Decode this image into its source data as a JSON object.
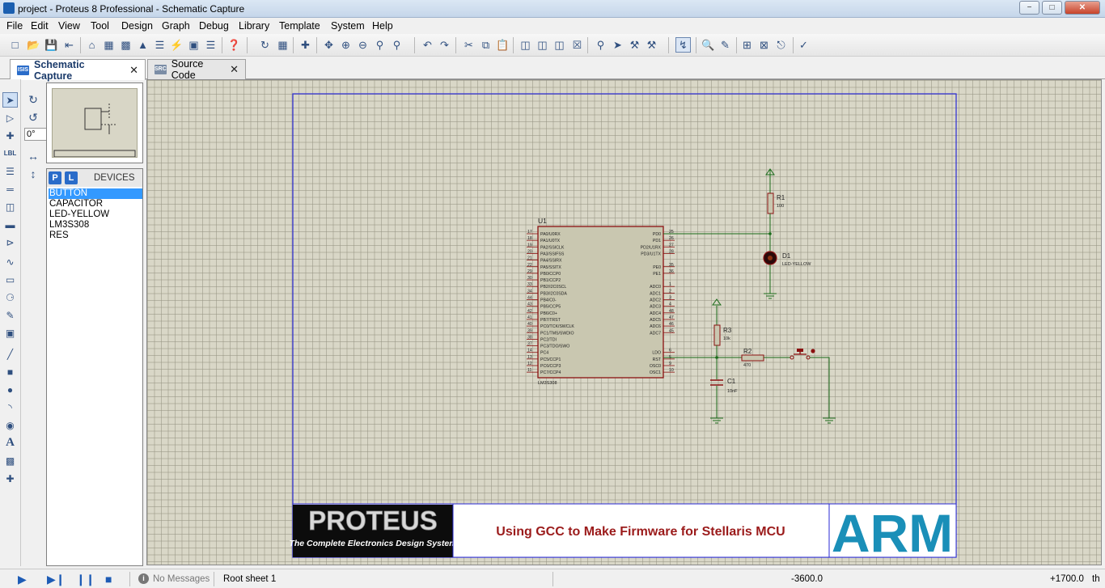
{
  "window": {
    "title": "project - Proteus 8 Professional - Schematic Capture",
    "minimize": "−",
    "maximize": "□",
    "close": "✕"
  },
  "menu": [
    "File",
    "Edit",
    "View",
    "Tool",
    "Design",
    "Graph",
    "Debug",
    "Library",
    "Template",
    "System",
    "Help"
  ],
  "toolbar": {
    "icons": [
      "new-icon",
      "open-icon",
      "save-icon",
      "import-icon",
      "home-icon",
      "schematic-icon",
      "pcb-icon",
      "3d-icon",
      "bom-icon",
      "help-icon",
      "refresh-icon",
      "grid-icon",
      "origin-icon",
      "pan-icon",
      "zoom-in-icon",
      "zoom-out-icon",
      "zoom-all-icon",
      "zoom-area-icon",
      "undo-icon",
      "redo-icon",
      "cut-icon",
      "copy-icon",
      "paste-icon",
      "block-copy-icon",
      "block-move-icon",
      "block-rotate-icon",
      "block-delete-icon",
      "pick-icon",
      "make-device-icon",
      "packaging-icon",
      "decompose-icon",
      "wire-autorouter-icon",
      "search-icon",
      "property-assign-icon",
      "new-sheet-icon",
      "remove-sheet-icon",
      "exit-to-parent-icon",
      "electrical-rule-check-icon"
    ]
  },
  "tabs": [
    {
      "label": "Schematic Capture",
      "icon": "ISIS",
      "active": true,
      "close": "✕"
    },
    {
      "label": "Source Code",
      "icon": "SRC",
      "active": false,
      "close": "✕"
    }
  ],
  "rotation": {
    "angle": "0°"
  },
  "devices": {
    "p_label": "P",
    "l_label": "L",
    "title": "DEVICES",
    "items": [
      "BUTTON",
      "CAPACITOR",
      "LED-YELLOW",
      "LM3S308",
      "RES"
    ],
    "selected_index": 0
  },
  "schematic": {
    "mcu": {
      "ref": "U1",
      "part": "LM3S308",
      "left_pins": [
        {
          "num": "17",
          "name": "PA0/U0RX"
        },
        {
          "num": "18",
          "name": "PA1/U0TX"
        },
        {
          "num": "19",
          "name": "PA2/SSICLK"
        },
        {
          "num": "20",
          "name": "PA3/SSIFSS"
        },
        {
          "num": "21",
          "name": "PA4/SSIRX"
        },
        {
          "num": "22",
          "name": "PA5/SSITX"
        },
        {
          "num": "29",
          "name": "PB0/CCP0"
        },
        {
          "num": "30",
          "name": "PB1/CCP2"
        },
        {
          "num": "33",
          "name": "PB2/I2C0SCL"
        },
        {
          "num": "34",
          "name": "PB3/I2C0SDA"
        },
        {
          "num": "44",
          "name": "PB4/C0-"
        },
        {
          "num": "43",
          "name": "PB5/CCP5"
        },
        {
          "num": "42",
          "name": "PB6/C0+"
        },
        {
          "num": "41",
          "name": "PB7/TRST"
        },
        {
          "num": "40",
          "name": "PC0/TCK/SWCLK"
        },
        {
          "num": "39",
          "name": "PC1/TMS/SWDIO"
        },
        {
          "num": "38",
          "name": "PC2/TDI"
        },
        {
          "num": "37",
          "name": "PC3/TDO/SWO"
        },
        {
          "num": "14",
          "name": "PC4"
        },
        {
          "num": "13",
          "name": "PC5/CCP1"
        },
        {
          "num": "12",
          "name": "PC6/CCP3"
        },
        {
          "num": "11",
          "name": "PC7/CCP4"
        }
      ],
      "right_pins": [
        {
          "num": "25",
          "name": "PD0",
          "row": 0
        },
        {
          "num": "26",
          "name": "PD1",
          "row": 1
        },
        {
          "num": "27",
          "name": "PD2/U1RX",
          "row": 2
        },
        {
          "num": "28",
          "name": "PD3/U1TX",
          "row": 3
        },
        {
          "num": "35",
          "name": "PE0",
          "row": 5
        },
        {
          "num": "36",
          "name": "PE1",
          "row": 6
        },
        {
          "num": "1",
          "name": "ADC0",
          "row": 8
        },
        {
          "num": "2",
          "name": "ADC1",
          "row": 9
        },
        {
          "num": "3",
          "name": "ADC2",
          "row": 10
        },
        {
          "num": "4",
          "name": "ADC3",
          "row": 11
        },
        {
          "num": "48",
          "name": "ADC4",
          "row": 12
        },
        {
          "num": "47",
          "name": "ADC5",
          "row": 13
        },
        {
          "num": "46",
          "name": "ADC6",
          "row": 14
        },
        {
          "num": "45",
          "name": "ADC7",
          "row": 15
        },
        {
          "num": "6",
          "name": "LDO",
          "row": 18
        },
        {
          "num": "5",
          "name": "RST",
          "row": 19
        },
        {
          "num": "9",
          "name": "OSC0",
          "row": 20
        },
        {
          "num": "10",
          "name": "OSC1",
          "row": 21
        }
      ]
    },
    "r1": {
      "ref": "R1",
      "value": "100"
    },
    "d1": {
      "ref": "D1",
      "value": "LED-YELLOW"
    },
    "r3": {
      "ref": "R3",
      "value": "10k"
    },
    "r2": {
      "ref": "R2",
      "value": "470"
    },
    "c1": {
      "ref": "C1",
      "value": "10nF"
    }
  },
  "title_block": {
    "logo_main": "PROTEUS",
    "logo_sub": "The Complete Electronics Design System",
    "caption": "Using GCC to Make Firmware for Stellaris MCU",
    "brand": "ARM",
    "caption_color": "#9b1b1b",
    "brand_color": "#1a8fb8"
  },
  "status": {
    "messages": "No Messages",
    "sheet": "Root sheet 1",
    "x": "-3600.0",
    "y": "+1700.0",
    "unit": "th"
  }
}
